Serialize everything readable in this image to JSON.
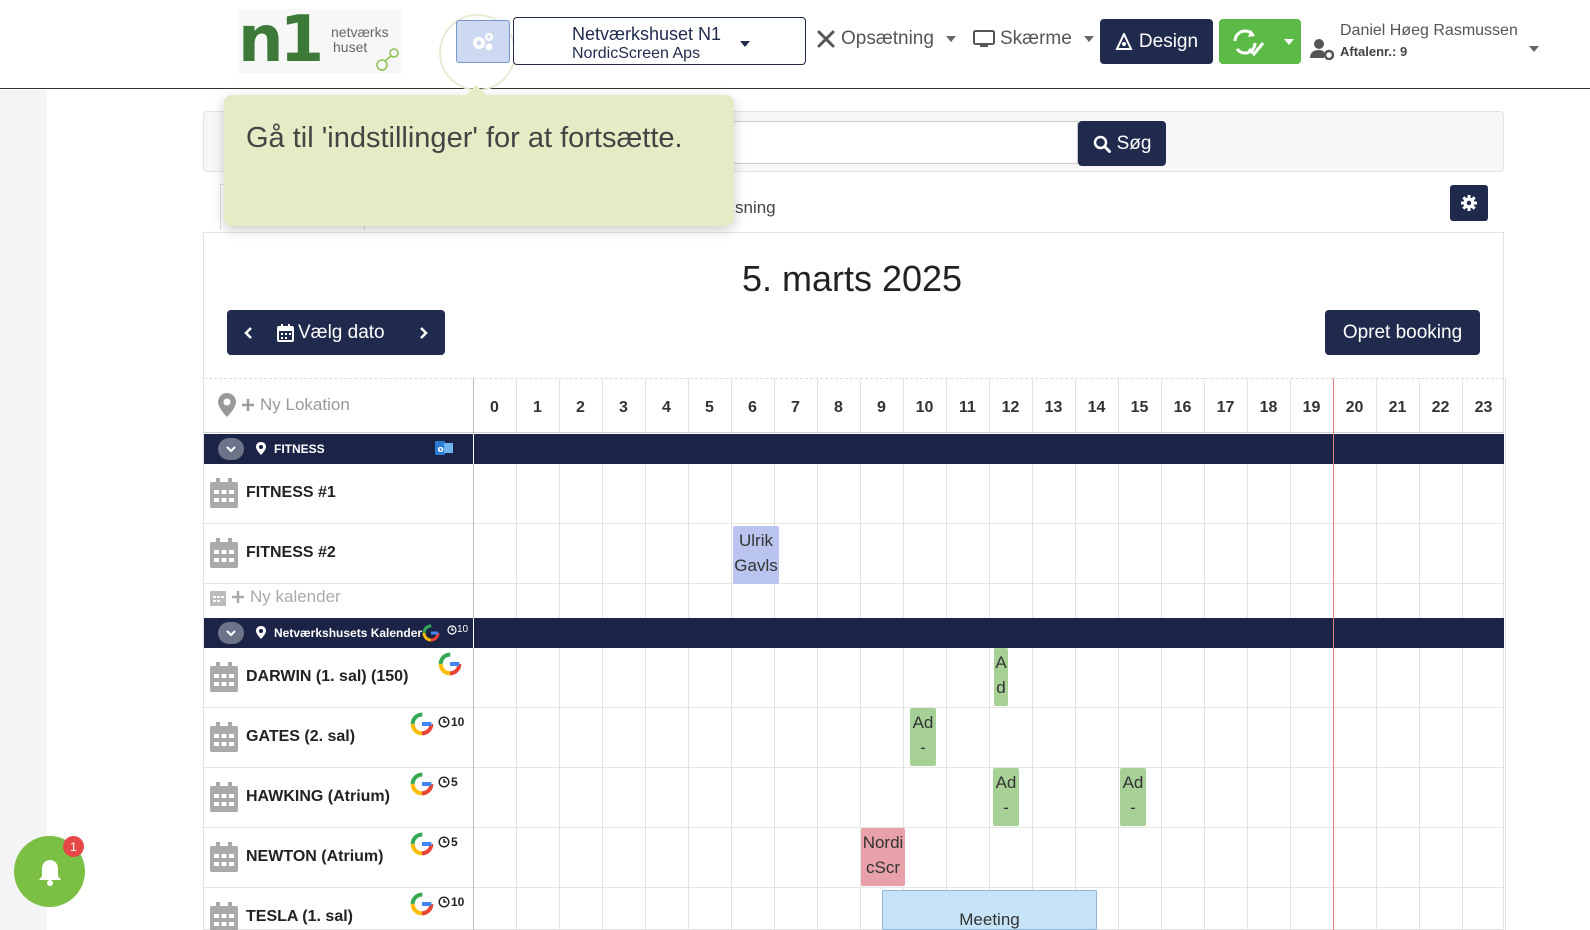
{
  "app": {
    "logo_mark": "n1",
    "logo_text_1": "netværks",
    "logo_text_2": "huset"
  },
  "org_selector": {
    "name": "Netværkshuset N1",
    "company": "NordicScreen Aps"
  },
  "menu": {
    "setup_label": "Opsætning",
    "screens_label": "Skærme",
    "design_label": "Design"
  },
  "user": {
    "name": "Daniel Høeg Rasmussen",
    "agreement": "Aftalenr.: 9"
  },
  "search": {
    "button_label": "Søg",
    "placeholder": ""
  },
  "tabs": {
    "visible_tab_text": "sning"
  },
  "tooltip": {
    "text": "Gå til 'indstillinger' for at fortsætte."
  },
  "calendar": {
    "date_title": "5. marts 2025",
    "pick_date_label": "Vælg dato",
    "create_booking_label": "Opret booking",
    "new_location_label": "Ny Lokation",
    "new_calendar_label": "Ny kalender",
    "hours": [
      "0",
      "1",
      "2",
      "3",
      "4",
      "5",
      "6",
      "7",
      "8",
      "9",
      "10",
      "11",
      "12",
      "13",
      "14",
      "15",
      "16",
      "17",
      "18",
      "19",
      "20",
      "21",
      "22",
      "23"
    ],
    "now_hour": 20,
    "groups": [
      {
        "name": "FITNESS",
        "rows": [
          {
            "name": "FITNESS #1"
          },
          {
            "name": "FITNESS #2"
          }
        ]
      },
      {
        "name": "Netværkshusets Kalender",
        "interval": "10",
        "rows": [
          {
            "name": "DARWIN (1. sal) (150)"
          },
          {
            "name": "GATES (2. sal)",
            "interval": "10"
          },
          {
            "name": "HAWKING (Atrium)",
            "interval": "5"
          },
          {
            "name": "NEWTON (Atrium)",
            "interval": "5"
          },
          {
            "name": "TESLA (1. sal)",
            "interval": "10"
          }
        ]
      }
    ],
    "events": [
      {
        "label": "Ulrik Gavls",
        "row": "FITNESS #2"
      },
      {
        "label": "A d",
        "row": "DARWIN (1. sal) (150)"
      },
      {
        "label": "Ad -",
        "row": "GATES (2. sal)"
      },
      {
        "label": "Ad -",
        "row": "HAWKING (Atrium)"
      },
      {
        "label": "Ad -",
        "row": "HAWKING (Atrium)"
      },
      {
        "label": "Nordi cScr",
        "row": "NEWTON (Atrium)"
      },
      {
        "label": "Meeting",
        "row": "TESLA (1. sal)"
      }
    ]
  },
  "notifications": {
    "count": "1"
  },
  "colors": {
    "navy": "#1f2a4d",
    "green": "#5cba47",
    "event_green": "#a6d096",
    "event_blue": "#b9c5ee",
    "event_red": "#e8a1a8",
    "event_lightblue": "#c7e3f7",
    "tooltip_bg": "#e4ecc6"
  }
}
